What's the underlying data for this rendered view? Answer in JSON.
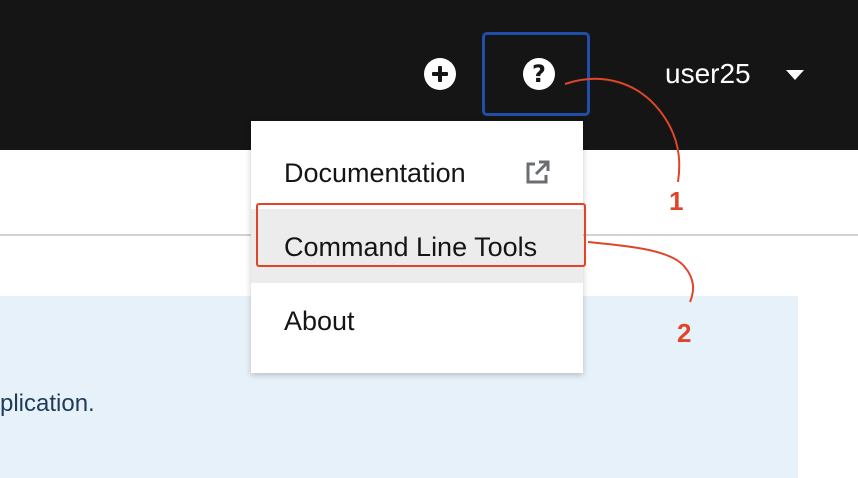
{
  "header": {
    "user_name": "user25",
    "add_icon": "plus-circle-icon",
    "help_icon": "question-circle-icon",
    "help_glyph": "?",
    "dropdown_icon": "caret-down-icon"
  },
  "help_menu": {
    "items": [
      {
        "label": "Documentation",
        "icon": "external-link-icon"
      },
      {
        "label": "Command Line Tools"
      },
      {
        "label": "About"
      }
    ]
  },
  "alert": {
    "text": "plication."
  },
  "annotations": {
    "step_1": "1",
    "step_2": "2",
    "color": "#e0452a",
    "focus_color": "#1f4fa8"
  }
}
